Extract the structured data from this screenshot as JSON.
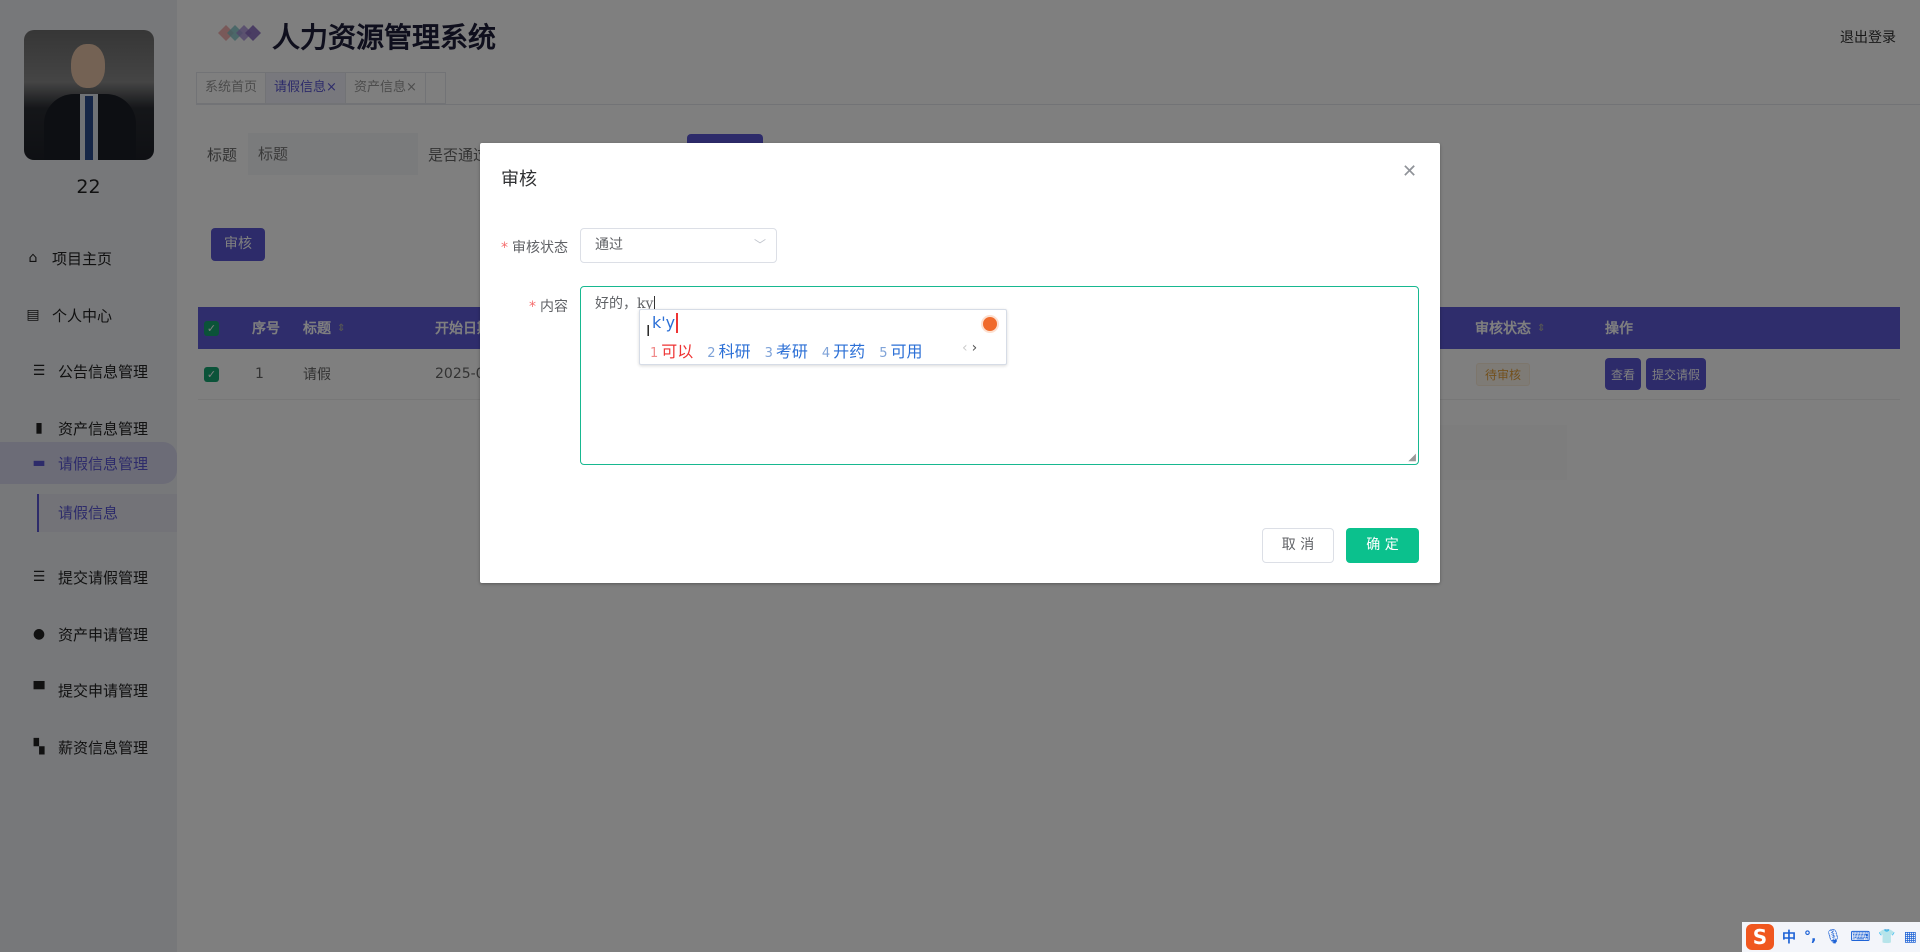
{
  "sidebar": {
    "username": "22",
    "items": [
      {
        "label": "项目主页",
        "icon": "home-icon"
      },
      {
        "label": "个人中心",
        "icon": "wallet-icon"
      },
      {
        "label": "公告信息管理",
        "icon": "sliders-icon"
      },
      {
        "label": "资产信息管理",
        "icon": "bar-chart-icon"
      },
      {
        "label": "请假信息管理",
        "icon": "message-icon",
        "active": true
      },
      {
        "label": "提交请假管理",
        "icon": "list-indent-icon"
      },
      {
        "label": "资产申请管理",
        "icon": "bulb-icon"
      },
      {
        "label": "提交申请管理",
        "icon": "monitor-icon"
      },
      {
        "label": "薪资信息管理",
        "icon": "grid-icon"
      }
    ],
    "subitem": "请假信息"
  },
  "header": {
    "title": "人力资源管理系统",
    "logout": "退出登录"
  },
  "tabs": [
    {
      "label": "系统首页",
      "closable": false
    },
    {
      "label": "请假信息",
      "closable": true,
      "active": true
    },
    {
      "label": "资产信息",
      "closable": true
    }
  ],
  "tab_close": "×",
  "search": {
    "title_label": "标题",
    "title_placeholder": "标题",
    "pass_label": "是否通过"
  },
  "toolbar": {
    "audit": "审核"
  },
  "table": {
    "headers": [
      "序号",
      "标题",
      "开始日期",
      "审核状态",
      "操作"
    ],
    "sort_icon": "sort-icon",
    "rows": [
      {
        "index": "1",
        "title": "请假",
        "start": "2025-0",
        "status": "待审核",
        "actions": [
          "查看",
          "提交请假"
        ]
      }
    ]
  },
  "dialog": {
    "title": "审核",
    "status_label": "审核状态",
    "status_value": "通过",
    "content_label": "内容",
    "content_value": "好的，ky",
    "required": "*",
    "cancel": "取 消",
    "ok": "确 定"
  },
  "ime": {
    "composition": "k'y",
    "candidates": [
      {
        "n": "1",
        "t": "可以"
      },
      {
        "n": "2",
        "t": "科研"
      },
      {
        "n": "3",
        "t": "考研"
      },
      {
        "n": "4",
        "t": "开药"
      },
      {
        "n": "5",
        "t": "可用"
      }
    ],
    "prev": "‹",
    "next": "›"
  },
  "imebar": {
    "logo": "S",
    "mode": "中",
    "punct": "°,"
  },
  "colors": {
    "accent": "#5a56d4",
    "confirm": "#0bc18d",
    "focus": "#17b890",
    "ime_logo": "#f0571f"
  }
}
